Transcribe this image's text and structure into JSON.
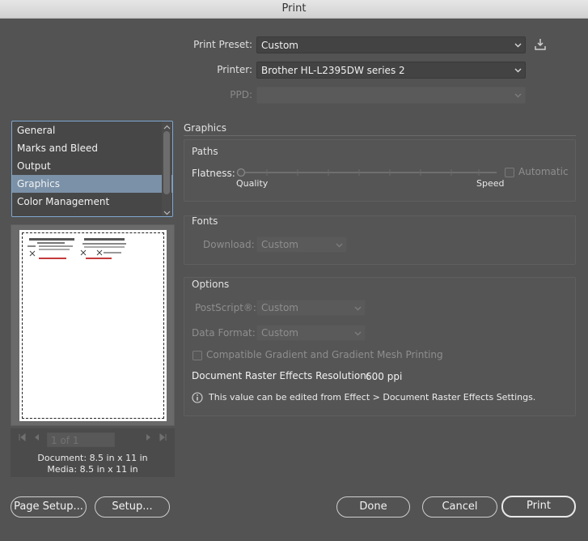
{
  "window": {
    "title": "Print"
  },
  "preset": {
    "label": "Print Preset:",
    "value": "Custom"
  },
  "printer": {
    "label": "Printer:",
    "value": "Brother HL-L2395DW series 2"
  },
  "ppd": {
    "label": "PPD:",
    "value": ""
  },
  "categories": {
    "items": [
      {
        "label": "General"
      },
      {
        "label": "Marks and Bleed"
      },
      {
        "label": "Output"
      },
      {
        "label": "Graphics",
        "selected": true
      },
      {
        "label": "Color Management"
      }
    ]
  },
  "preview": {
    "page_field": "1 of 1",
    "document": "Document: 8.5 in x 11 in",
    "media": "Media: 8.5 in x 11 in"
  },
  "graphics": {
    "title": "Graphics",
    "paths": {
      "title": "Paths",
      "flatness_label": "Flatness:",
      "quality_label": "Quality",
      "speed_label": "Speed",
      "automatic_label": "Automatic",
      "slider_value": 0
    },
    "fonts": {
      "title": "Fonts",
      "download_label": "Download:",
      "download_value": "Custom"
    },
    "options": {
      "title": "Options",
      "postscript_label": "PostScript®:",
      "postscript_value": "Custom",
      "data_format_label": "Data Format:",
      "data_format_value": "Custom",
      "compatible_gradient_label": "Compatible Gradient and Gradient Mesh Printing",
      "raster_label": "Document Raster Effects Resolution:",
      "raster_value": "600 ppi",
      "info_text": "This value can be edited from Effect > Document Raster Effects Settings."
    }
  },
  "buttons": {
    "page_setup": "Page Setup...",
    "setup": "Setup...",
    "done": "Done",
    "cancel": "Cancel",
    "print": "Print"
  },
  "colors": {
    "background": "#535353",
    "selection": "#7a91a8",
    "list_focus": "#7fa7d1"
  }
}
